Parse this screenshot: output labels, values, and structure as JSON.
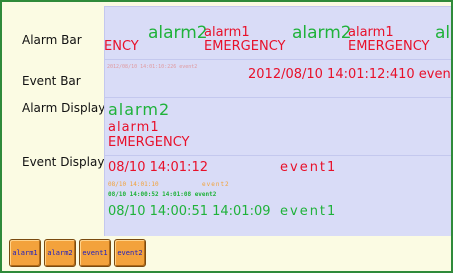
{
  "labels": {
    "alarm_bar": "Alarm Bar",
    "event_bar": "Event Bar",
    "alarm_display": "Alarm Display",
    "event_display": "Event Display"
  },
  "alarm_bar": {
    "items": [
      {
        "text": "ENCY"
      },
      {
        "text": "alarm2"
      },
      {
        "text": "alarm1"
      },
      {
        "text": "EMERGENCY"
      },
      {
        "text": "alarm2"
      },
      {
        "text": "alarm1"
      },
      {
        "text": "EMERGENCY"
      },
      {
        "text": "al"
      }
    ]
  },
  "event_bar": {
    "small": "2012/08/10 14:01:10:226 event2",
    "large": "2012/08/10  14:01:12:410  even"
  },
  "alarm_display": {
    "line1": "alarm2",
    "line2": "alarm1",
    "line3": "EMERGENCY"
  },
  "event_display": {
    "row1_time": "08/10  14:01:12",
    "row1_name": "event1",
    "row2_time": "08/10 14:01:10",
    "row2_name": "event2",
    "row3": "08/10 14:00:52 14:01:08 event2",
    "row4_time": "08/10  14:00:51  14:01:09",
    "row4_name": "event1"
  },
  "buttons": [
    "alarm1",
    "alarm2",
    "event1",
    "event2"
  ],
  "colors": {
    "frame_border": "#2f8a3a",
    "background": "#fbfbe3",
    "panel": "#d9dcf7",
    "red": "#e8102a",
    "green": "#1fb23a",
    "orange": "#f2a23a",
    "button": "#f3a23c",
    "button_text": "#2020c0"
  }
}
